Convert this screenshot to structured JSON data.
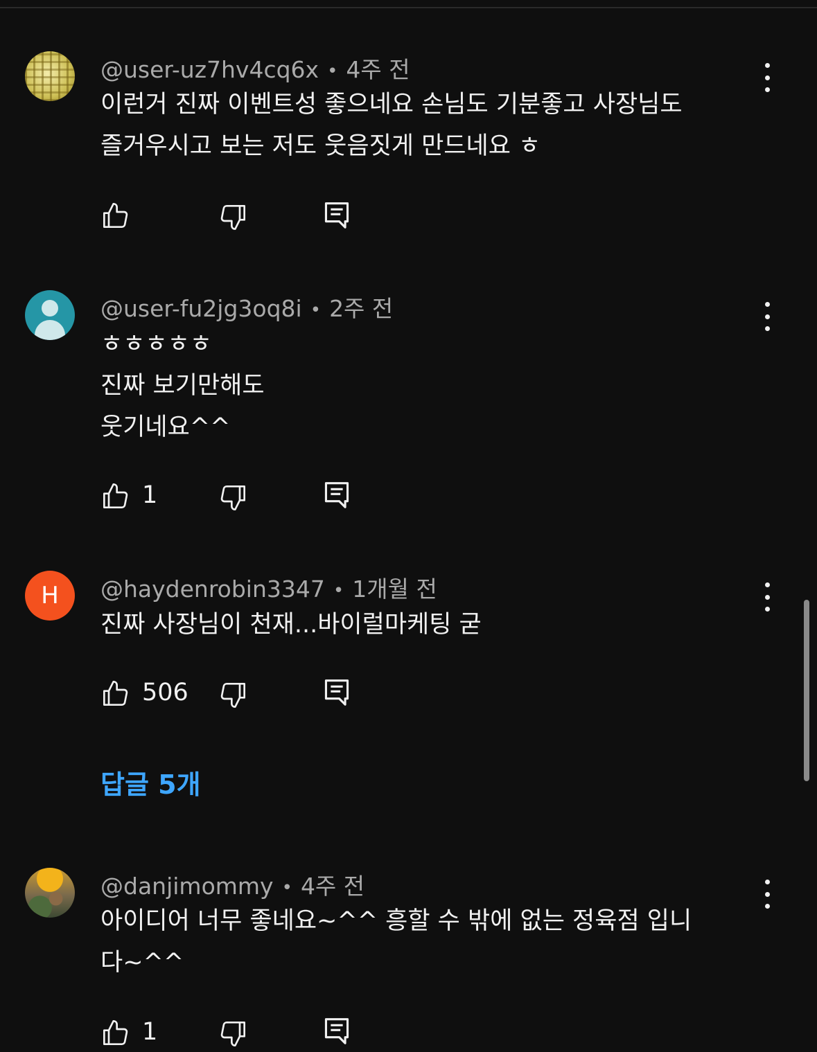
{
  "comments": [
    {
      "author": "@user-uz7hv4cq6x",
      "time": "4주 전",
      "text": "이런거 진짜 이벤트성 좋으네요 손님도 기분좋고 사장님도\n즐거우시고 보는 저도 웃음짓게 만드네요 ㅎ",
      "likes": ""
    },
    {
      "author": "@user-fu2jg3oq8i",
      "time": "2주 전",
      "text": "ㅎㅎㅎㅎㅎ\n진짜 보기만해도\n웃기네요^^",
      "likes": "1"
    },
    {
      "author": "@haydenrobin3347",
      "time": "1개월 전",
      "avatar_letter": "H",
      "text": "진짜 사장님이 천재...바이럴마케팅 굳",
      "likes": "506",
      "replies_label": "답글 5개"
    },
    {
      "author": "@danjimommy",
      "time": "4주 전",
      "text": "아이디어 너무 좋네요~^^ 흥할 수 밖에 없는 정육점 입니\n다~^^",
      "likes": "1"
    }
  ],
  "separator": "•",
  "colors": {
    "background": "#0f0f0f",
    "text": "#f1f1f1",
    "meta": "#aaaaaa",
    "link": "#3ea6ff",
    "avatar_h": "#f4511e",
    "avatar_default": "#2596a6"
  },
  "icons": [
    "thumbs-up-icon",
    "thumbs-down-icon",
    "reply-icon",
    "more-vert-icon"
  ]
}
